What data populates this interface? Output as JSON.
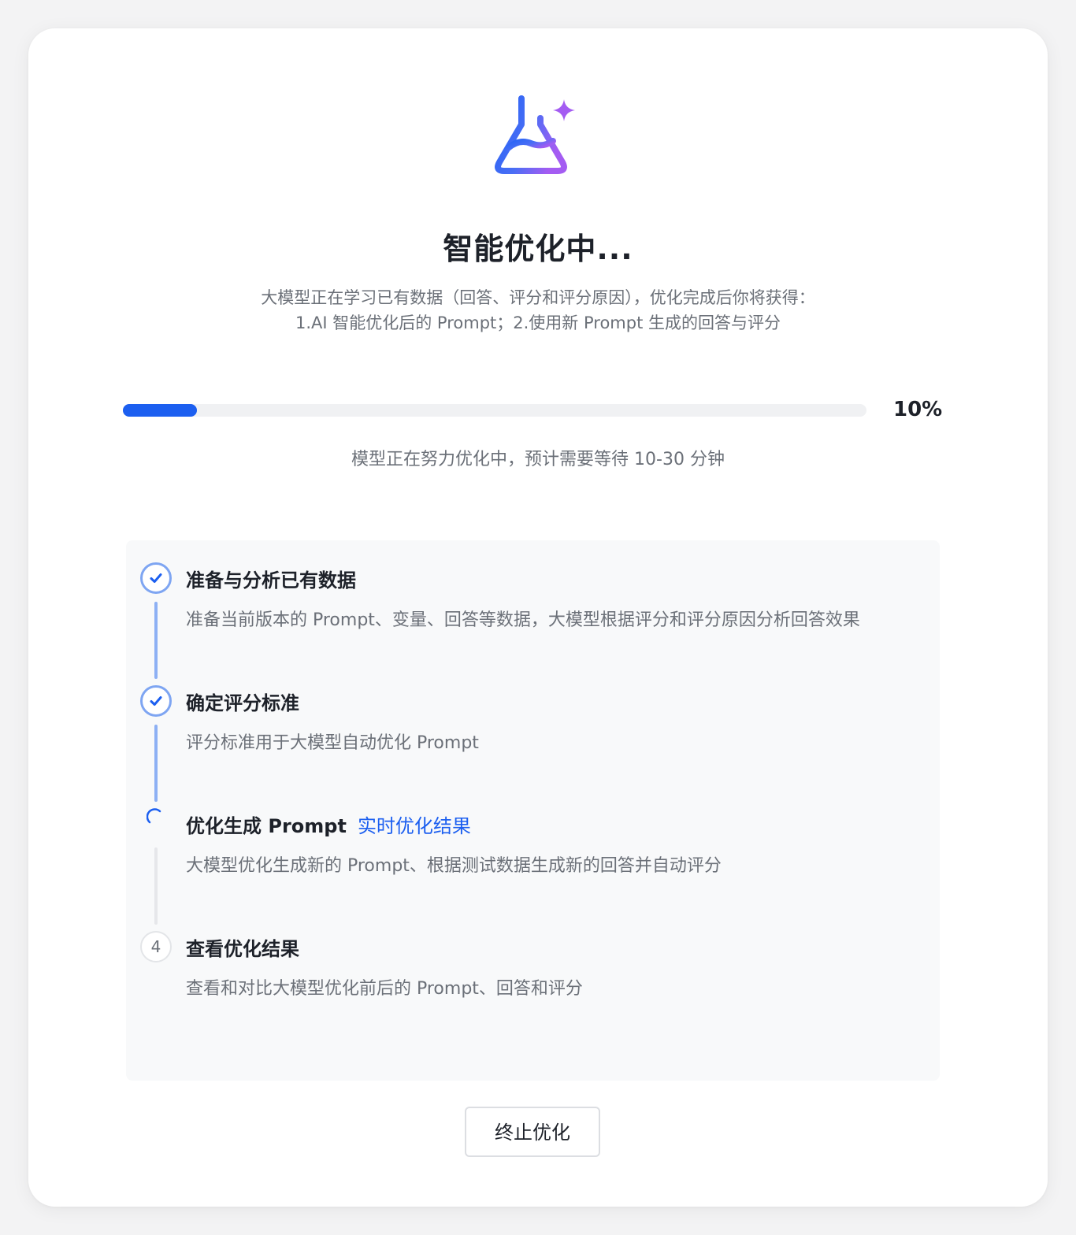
{
  "header": {
    "title": "智能优化中...",
    "description_line1": "大模型正在学习已有数据（回答、评分和评分原因），优化完成后你将获得：",
    "description_line2": "1.AI 智能优化后的 Prompt；2.使用新 Prompt 生成的回答与评分"
  },
  "progress": {
    "value": 10,
    "label": "10%",
    "hint": "模型正在努力优化中，预计需要等待 10-30 分钟"
  },
  "steps": [
    {
      "status": "done",
      "title": "准备与分析已有数据",
      "description": "准备当前版本的 Prompt、变量、回答等数据，大模型根据评分和评分原因分析回答效果"
    },
    {
      "status": "done",
      "title": "确定评分标准",
      "description": "评分标准用于大模型自动优化 Prompt"
    },
    {
      "status": "in-progress",
      "title": "优化生成 Prompt",
      "link": "实时优化结果",
      "description": "大模型优化生成新的 Prompt、根据测试数据生成新的回答并自动评分"
    },
    {
      "status": "pending",
      "number": "4",
      "title": "查看优化结果",
      "description": "查看和对比大模型优化前后的 Prompt、回答和评分"
    }
  ],
  "actions": {
    "stop_label": "终止优化"
  },
  "colors": {
    "accent": "#1c5ff0",
    "done_marker": "#7ea5f2",
    "icon_gradient_start": "#2563f5",
    "icon_gradient_end": "#a45cf2"
  },
  "icons": {
    "hero": "flask-sparkle-icon",
    "done": "check-icon",
    "loading": "spinner-icon"
  }
}
